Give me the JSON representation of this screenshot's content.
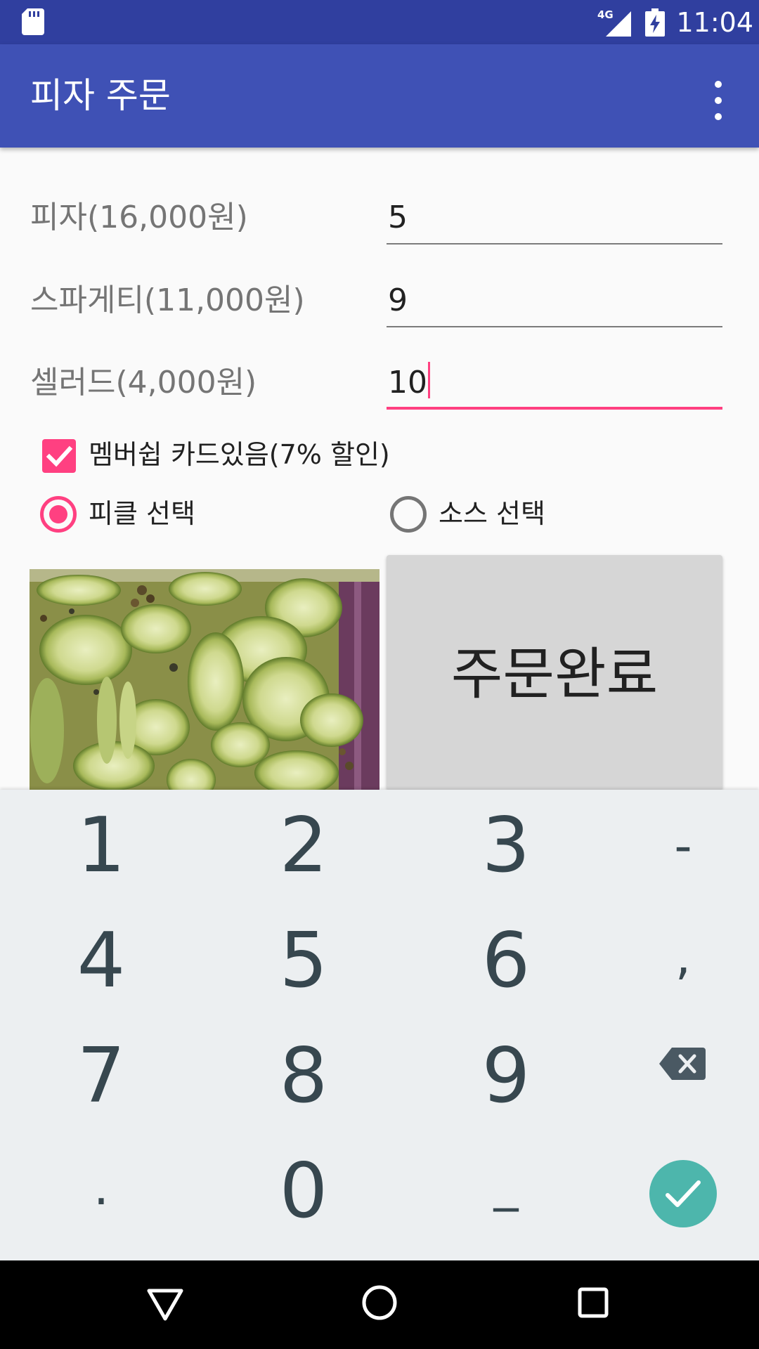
{
  "status_bar": {
    "network": "4G",
    "time": "11:04"
  },
  "app_bar": {
    "title": "피자 주문",
    "menu_icon": "overflow-menu-icon"
  },
  "form": {
    "pizza": {
      "label": "피자(16,000원)",
      "value": "5"
    },
    "spaghetti": {
      "label": "스파게티(11,000원)",
      "value": "9"
    },
    "salad": {
      "label": "셀러드(4,000원)",
      "value": "10"
    }
  },
  "membership": {
    "label": "멤버쉽 카드있음(7% 할인)",
    "checked": true
  },
  "radios": {
    "pickle": {
      "label": "피클 선택",
      "selected": true
    },
    "sauce": {
      "label": "소스 선택",
      "selected": false
    }
  },
  "order_button": {
    "label": "주문완료"
  },
  "keyboard": {
    "rows": [
      [
        "1",
        "2",
        "3",
        "-"
      ],
      [
        "4",
        "5",
        "6",
        ","
      ],
      [
        "7",
        "8",
        "9",
        "backspace-icon"
      ],
      [
        ".",
        "0",
        "_",
        "enter-check-icon"
      ]
    ]
  },
  "colors": {
    "status_bar": "#303f9f",
    "app_bar": "#3f51b5",
    "accent": "#ff4081",
    "keyboard_bg": "#eceff1",
    "key_text": "#37474f",
    "enter_key": "#4db6ac",
    "button_bg": "#d6d6d6"
  }
}
